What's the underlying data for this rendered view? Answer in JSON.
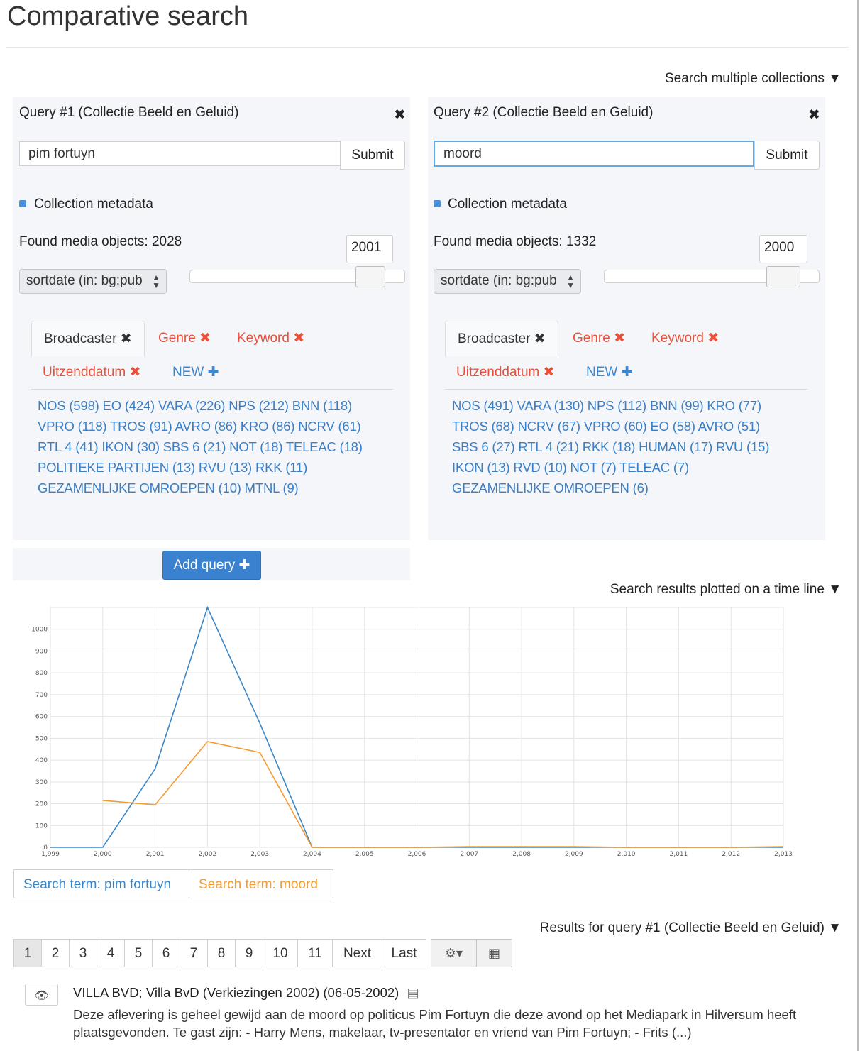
{
  "page": {
    "title": "Comparative search"
  },
  "sections": {
    "multi_collections": "Search multiple collections ▼",
    "timeline": "Search results plotted on a time line ▼",
    "results": "Results for query #1 (Collectie Beeld en Geluid) ▼"
  },
  "queries": [
    {
      "title": "Query #1 (Collectie Beeld en Geluid)",
      "input_value": "pim fortuyn",
      "submit_label": "Submit",
      "metadata_label": "Collection metadata",
      "found_label": "Found media objects: 2028",
      "year_value": "2001",
      "sort_value": "sortdate (in: bg:pub",
      "slider_position": 0.92,
      "tabs": {
        "broadcaster": "Broadcaster ✖",
        "genre": "Genre ✖",
        "keyword": "Keyword ✖",
        "uitzenddatum": "Uitzenddatum ✖",
        "new": "NEW ✚"
      },
      "facets": [
        "NOS (598) EO (424) VARA (226) NPS (212) BNN (118)",
        "VPRO (118) TROS (91) AVRO (86) KRO (86) NCRV (61)",
        "RTL 4 (41) IKON (30) SBS 6 (21) NOT (18) TELEAC (18)",
        "POLITIEKE PARTIJEN (13) RVU (13) RKK (11)",
        "GEZAMENLIJKE OMROEPEN (10) MTNL (9)"
      ]
    },
    {
      "title": "Query #2 (Collectie Beeld en Geluid)",
      "input_value": "moord",
      "submit_label": "Submit",
      "metadata_label": "Collection metadata",
      "found_label": "Found media objects: 1332",
      "year_value": "2000",
      "sort_value": "sortdate (in: bg:pub",
      "slider_position": 0.9,
      "tabs": {
        "broadcaster": "Broadcaster ✖",
        "genre": "Genre ✖",
        "keyword": "Keyword ✖",
        "uitzenddatum": "Uitzenddatum ✖",
        "new": "NEW ✚"
      },
      "facets": [
        "NOS (491) VARA (130) NPS (112) BNN (99) KRO (77)",
        "TROS (68) NCRV (67) VPRO (60) EO (58) AVRO (51)",
        "SBS 6 (27) RTL 4 (21) RKK (18) HUMAN (17) RVU (15)",
        "IKON (13) RVD (10) NOT (7) TELEAC (7)",
        "GEZAMENLIJKE OMROEPEN (6)"
      ]
    }
  ],
  "add_query_label": "Add query ✚",
  "icons": {
    "close": "close-icon",
    "bullet": "bullet-icon",
    "sort_arrows": "up-down-arrows-icon",
    "gear": "gear-icon",
    "calendar": "calendar-icon",
    "eye": "eye-icon",
    "film": "film-icon"
  },
  "icon_glyphs": {
    "close": "✖",
    "gear": "⚙▾",
    "calendar": "▦",
    "eye": "👁",
    "film": "▤"
  },
  "chart_data": {
    "type": "line",
    "x": [
      1999,
      2000,
      2001,
      2002,
      2003,
      2004,
      2005,
      2006,
      2007,
      2008,
      2009,
      2010,
      2011,
      2012,
      2013
    ],
    "x_tick_labels": [
      "1,999",
      "2,000",
      "2,001",
      "2,002",
      "2,003",
      "2,004",
      "2,005",
      "2,006",
      "2,007",
      "2,008",
      "2,009",
      "2,010",
      "2,011",
      "2,012",
      "2,013"
    ],
    "y_ticks": [
      0,
      100,
      200,
      300,
      400,
      500,
      600,
      700,
      800,
      900,
      1000
    ],
    "ylim": [
      0,
      1100
    ],
    "grid": true,
    "series": [
      {
        "name": "Search term: pim fortuyn",
        "color": "#3a86c8",
        "values": [
          0,
          0,
          360,
          1100,
          570,
          0,
          0,
          0,
          0,
          0,
          0,
          0,
          0,
          0,
          0
        ]
      },
      {
        "name": "Search term: moord",
        "color": "#f39a32",
        "values": [
          null,
          215,
          195,
          485,
          435,
          0,
          0,
          0,
          3,
          3,
          3,
          0,
          0,
          0,
          3
        ]
      }
    ]
  },
  "pagination": {
    "pages": [
      "1",
      "2",
      "3",
      "4",
      "5",
      "6",
      "7",
      "8",
      "9",
      "10",
      "11"
    ],
    "next": "Next",
    "last": "Last",
    "active_page": "1"
  },
  "result": {
    "title": "VILLA BVD; Villa BvD (Verkiezingen 2002) (06-05-2002)",
    "description": "Deze aflevering is geheel gewijd aan de moord op politicus Pim Fortuyn die deze avond op het Mediapark in Hilversum heeft plaatsgevonden. Te gast zijn: - Harry Mens, makelaar, tv-presentator en vriend van Pim Fortuyn; - Frits (...)"
  }
}
